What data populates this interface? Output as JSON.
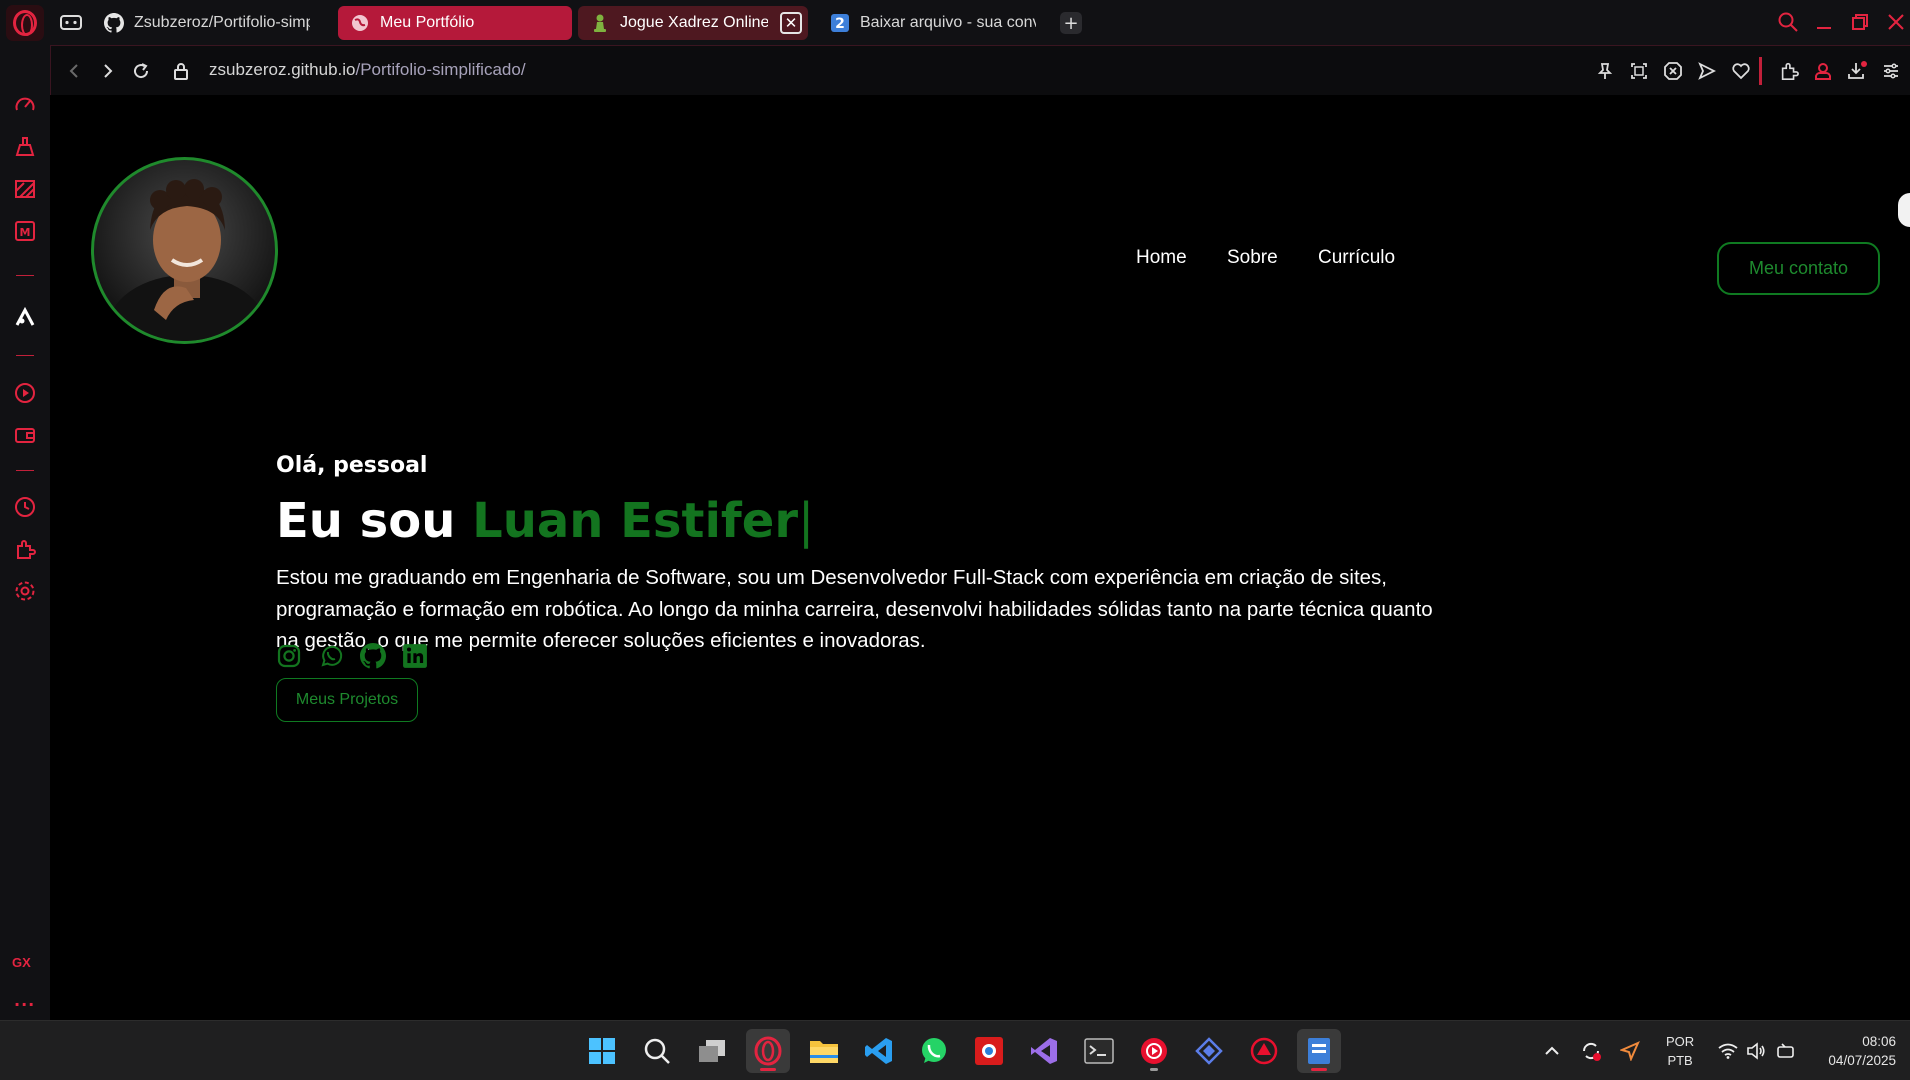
{
  "browser": {
    "tabs": [
      {
        "title": "Zsubzeroz/Portifolio-simplificado",
        "favicon": "github-icon"
      },
      {
        "title": "Meu Portfólio",
        "favicon": "globe-icon"
      },
      {
        "title": "Jogue Xadrez Online",
        "favicon": "chess-pawn-icon"
      },
      {
        "title": "Baixar arquivo - sua conversão",
        "favicon": "number-2-icon"
      }
    ],
    "tab_close_glyph": "✕",
    "new_tab_glyph": "+",
    "url_host": "zsubzeroz.github.io",
    "url_path": "/Portifolio-simplificado/"
  },
  "sidebar": {
    "gx_label": "GX",
    "more_label": "···"
  },
  "site": {
    "nav": [
      {
        "label": "Home"
      },
      {
        "label": "Sobre"
      },
      {
        "label": "Currículo"
      }
    ],
    "contact_button": "Meu contato",
    "greeting": "Olá, pessoal",
    "headline_prefix": "Eu sou",
    "headline_name": "Luan Estifer",
    "headline_caret": "|",
    "bio": "Estou me graduando em Engenharia de Software, sou um Desenvolvedor Full-Stack com experiência em criação de sites, programação e formação em robótica. Ao longo da minha carreira, desenvolvi habilidades sólidas tanto na parte técnica quanto na gestão, o que me permite oferecer soluções eficientes e inovadoras.",
    "socials": [
      "instagram-icon",
      "whatsapp-icon",
      "github-icon",
      "linkedin-icon"
    ],
    "projects_button": "Meus Projetos",
    "accent_color": "#13741f"
  },
  "taskbar": {
    "lang_line1": "POR",
    "lang_line2": "PTB",
    "time": "08:06",
    "date": "04/07/2025"
  }
}
